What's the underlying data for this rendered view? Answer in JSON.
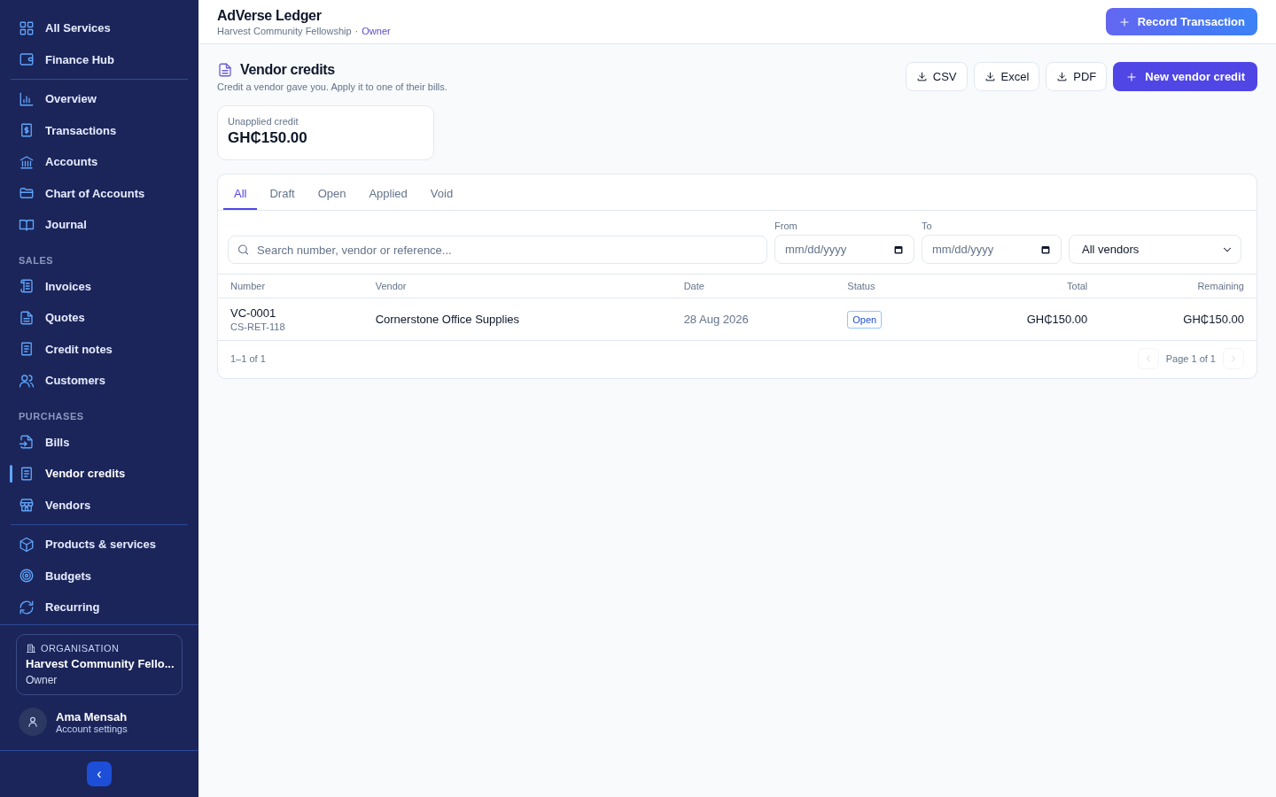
{
  "sidebar": {
    "groups": [
      {
        "items": [
          {
            "label": "All Services",
            "selected": false
          },
          {
            "label": "Finance Hub",
            "selected": false
          }
        ]
      },
      {
        "items": [
          {
            "label": "Overview",
            "selected": false
          },
          {
            "label": "Transactions",
            "selected": false
          },
          {
            "label": "Accounts",
            "selected": false
          },
          {
            "label": "Chart of Accounts",
            "selected": false
          },
          {
            "label": "Journal",
            "selected": false
          }
        ]
      },
      {
        "heading": "SALES",
        "items": [
          {
            "label": "Invoices",
            "selected": false
          },
          {
            "label": "Quotes",
            "selected": false
          },
          {
            "label": "Credit notes",
            "selected": false
          },
          {
            "label": "Customers",
            "selected": false
          }
        ]
      },
      {
        "heading": "PURCHASES",
        "items": [
          {
            "label": "Bills",
            "selected": false
          },
          {
            "label": "Vendor credits",
            "selected": true
          },
          {
            "label": "Vendors",
            "selected": false
          }
        ]
      },
      {
        "items": [
          {
            "label": "Products & services",
            "selected": false
          },
          {
            "label": "Budgets",
            "selected": false
          },
          {
            "label": "Recurring",
            "selected": false
          }
        ]
      }
    ],
    "organisation": {
      "label": "ORGANISATION",
      "name": "Harvest Community Fello...",
      "role": "Owner"
    },
    "user": {
      "name": "Ama Mensah",
      "link": "Account settings"
    },
    "collapse": "‹"
  },
  "header": {
    "title": "AdVerse Ledger",
    "org": "Harvest Community Fellowship",
    "separator": "·",
    "role": "Owner",
    "action": "Record Transaction"
  },
  "page": {
    "title": "Vendor credits",
    "subtitle": "Credit a vendor gave you. Apply it to one of their bills.",
    "exports": [
      "CSV",
      "Excel",
      "PDF"
    ],
    "primary": "New vendor credit",
    "summary": {
      "label": "Unapplied credit",
      "value": "GH₵150.00"
    }
  },
  "tabs": [
    {
      "label": "All",
      "selected": true
    },
    {
      "label": "Draft",
      "selected": false
    },
    {
      "label": "Open",
      "selected": false
    },
    {
      "label": "Applied",
      "selected": false
    },
    {
      "label": "Void",
      "selected": false
    }
  ],
  "filters": {
    "search": {
      "placeholder": "Search number, vendor or reference..."
    },
    "from": {
      "label": "From",
      "placeholder": "mm/dd/yyyy"
    },
    "to": {
      "label": "To",
      "placeholder": "mm/dd/yyyy"
    },
    "vendor": {
      "value": "All vendors"
    }
  },
  "table": {
    "columns": [
      "Number",
      "Vendor",
      "Date",
      "Status",
      "Total",
      "Remaining"
    ],
    "rows": [
      {
        "number": "VC-0001",
        "reference": "CS-RET-118",
        "vendor": "Cornerstone Office Supplies",
        "date": "28 Aug 2026",
        "status": "Open",
        "total": "GH₵150.00",
        "remaining": "GH₵150.00"
      }
    ]
  },
  "footer": {
    "count": "1–1 of 1",
    "page": "Page 1 of 1"
  }
}
